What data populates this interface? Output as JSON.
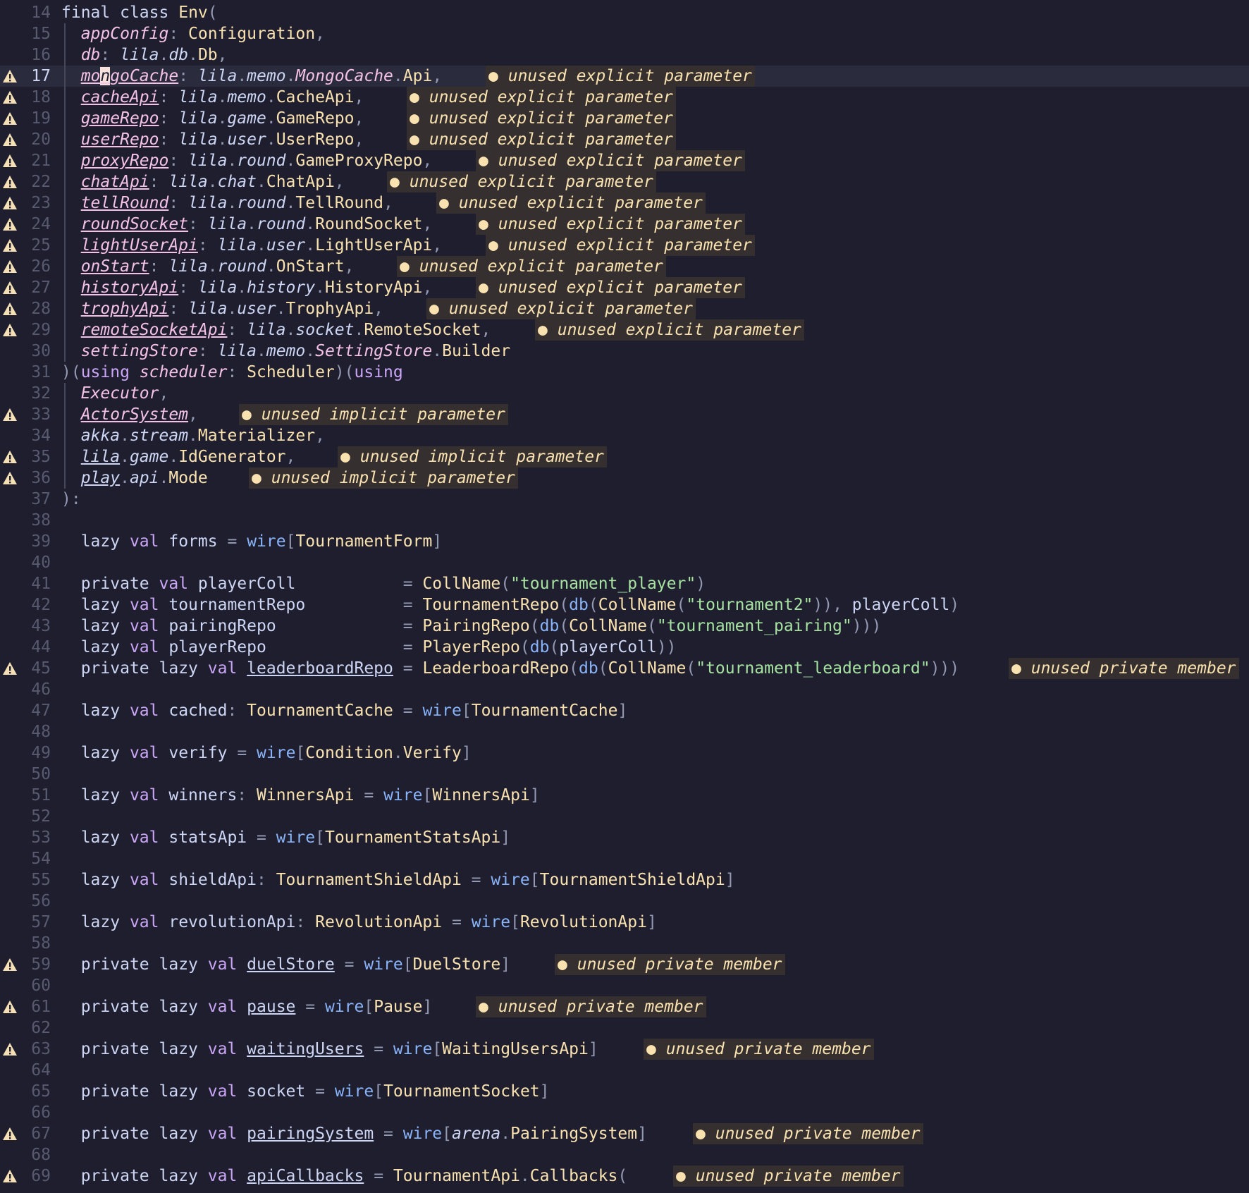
{
  "editor": {
    "diagnostics": {
      "unused_explicit": "unused explicit parameter",
      "unused_implicit": "unused implicit parameter",
      "unused_private": "unused private member"
    },
    "lines": [
      {
        "n": "14",
        "text": "final class Env("
      },
      {
        "n": "15",
        "text": "  appConfig: Configuration,"
      },
      {
        "n": "16",
        "text": "  db: lila.db.Db,"
      },
      {
        "n": "17",
        "text": "  mongoCache: lila.memo.MongoCache.Api,",
        "diag": "unused explicit parameter",
        "current": true
      },
      {
        "n": "18",
        "text": "  cacheApi: lila.memo.CacheApi,",
        "diag": "unused explicit parameter"
      },
      {
        "n": "19",
        "text": "  gameRepo: lila.game.GameRepo,",
        "diag": "unused explicit parameter"
      },
      {
        "n": "20",
        "text": "  userRepo: lila.user.UserRepo,",
        "diag": "unused explicit parameter"
      },
      {
        "n": "21",
        "text": "  proxyRepo: lila.round.GameProxyRepo,",
        "diag": "unused explicit parameter"
      },
      {
        "n": "22",
        "text": "  chatApi: lila.chat.ChatApi,",
        "diag": "unused explicit parameter"
      },
      {
        "n": "23",
        "text": "  tellRound: lila.round.TellRound,",
        "diag": "unused explicit parameter"
      },
      {
        "n": "24",
        "text": "  roundSocket: lila.round.RoundSocket,",
        "diag": "unused explicit parameter"
      },
      {
        "n": "25",
        "text": "  lightUserApi: lila.user.LightUserApi,",
        "diag": "unused explicit parameter"
      },
      {
        "n": "26",
        "text": "  onStart: lila.round.OnStart,",
        "diag": "unused explicit parameter"
      },
      {
        "n": "27",
        "text": "  historyApi: lila.history.HistoryApi,",
        "diag": "unused explicit parameter"
      },
      {
        "n": "28",
        "text": "  trophyApi: lila.user.TrophyApi,",
        "diag": "unused explicit parameter"
      },
      {
        "n": "29",
        "text": "  remoteSocketApi: lila.socket.RemoteSocket,",
        "diag": "unused explicit parameter"
      },
      {
        "n": "30",
        "text": "  settingStore: lila.memo.SettingStore.Builder"
      },
      {
        "n": "31",
        "text": ")(using scheduler: Scheduler)(using"
      },
      {
        "n": "32",
        "text": "  Executor,"
      },
      {
        "n": "33",
        "text": "  ActorSystem,",
        "diag": "unused implicit parameter"
      },
      {
        "n": "34",
        "text": "  akka.stream.Materializer,"
      },
      {
        "n": "35",
        "text": "  lila.game.IdGenerator,",
        "diag": "unused implicit parameter"
      },
      {
        "n": "36",
        "text": "  play.api.Mode",
        "diag": "unused implicit parameter"
      },
      {
        "n": "37",
        "text": "):"
      },
      {
        "n": "38",
        "text": ""
      },
      {
        "n": "39",
        "text": "  lazy val forms = wire[TournamentForm]"
      },
      {
        "n": "40",
        "text": ""
      },
      {
        "n": "41",
        "text": "  private val playerColl           = CollName(\"tournament_player\")"
      },
      {
        "n": "42",
        "text": "  lazy val tournamentRepo          = TournamentRepo(db(CollName(\"tournament2\")), playerColl)"
      },
      {
        "n": "43",
        "text": "  lazy val pairingRepo             = PairingRepo(db(CollName(\"tournament_pairing\")))"
      },
      {
        "n": "44",
        "text": "  lazy val playerRepo              = PlayerRepo(db(playerColl))"
      },
      {
        "n": "45",
        "text": "  private lazy val leaderboardRepo = LeaderboardRepo(db(CollName(\"tournament_leaderboard\")))",
        "diag": "unused private member"
      },
      {
        "n": "46",
        "text": ""
      },
      {
        "n": "47",
        "text": "  lazy val cached: TournamentCache = wire[TournamentCache]"
      },
      {
        "n": "48",
        "text": ""
      },
      {
        "n": "49",
        "text": "  lazy val verify = wire[Condition.Verify]"
      },
      {
        "n": "50",
        "text": ""
      },
      {
        "n": "51",
        "text": "  lazy val winners: WinnersApi = wire[WinnersApi]"
      },
      {
        "n": "52",
        "text": ""
      },
      {
        "n": "53",
        "text": "  lazy val statsApi = wire[TournamentStatsApi]"
      },
      {
        "n": "54",
        "text": ""
      },
      {
        "n": "55",
        "text": "  lazy val shieldApi: TournamentShieldApi = wire[TournamentShieldApi]"
      },
      {
        "n": "56",
        "text": ""
      },
      {
        "n": "57",
        "text": "  lazy val revolutionApi: RevolutionApi = wire[RevolutionApi]"
      },
      {
        "n": "58",
        "text": ""
      },
      {
        "n": "59",
        "text": "  private lazy val duelStore = wire[DuelStore]",
        "diag": "unused private member"
      },
      {
        "n": "60",
        "text": ""
      },
      {
        "n": "61",
        "text": "  private lazy val pause = wire[Pause]",
        "diag": "unused private member"
      },
      {
        "n": "62",
        "text": ""
      },
      {
        "n": "63",
        "text": "  private lazy val waitingUsers = wire[WaitingUsersApi]",
        "diag": "unused private member"
      },
      {
        "n": "64",
        "text": ""
      },
      {
        "n": "65",
        "text": "  private lazy val socket = wire[TournamentSocket]"
      },
      {
        "n": "66",
        "text": ""
      },
      {
        "n": "67",
        "text": "  private lazy val pairingSystem = wire[arena.PairingSystem]",
        "diag": "unused private member"
      },
      {
        "n": "68",
        "text": ""
      },
      {
        "n": "69",
        "text": "  private lazy val apiCallbacks = TournamentApi.Callbacks(",
        "diag": "unused private member"
      }
    ]
  }
}
